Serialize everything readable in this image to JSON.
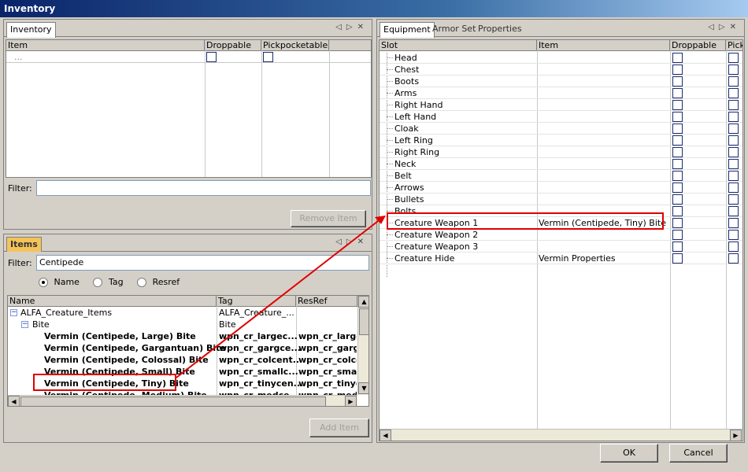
{
  "window": {
    "title": "Inventory"
  },
  "inventory_panel": {
    "tab": "Inventory",
    "columns": [
      "Item",
      "Droppable",
      "Pickpocketable"
    ],
    "placeholder_row": "...",
    "filter_label": "Filter:",
    "filter_value": "",
    "remove_button": "Remove Item"
  },
  "items_panel": {
    "tab": "Items",
    "filter_label": "Filter:",
    "filter_value": "Centipede",
    "radio": {
      "name": "Name",
      "tag": "Tag",
      "resref": "Resref",
      "selected": "Name"
    },
    "columns": [
      "Name",
      "Tag",
      "ResRef"
    ],
    "tree": [
      {
        "name": "ALFA_Creature_Items",
        "tag": "ALFA_Creature_...",
        "resref": ""
      },
      {
        "name": "Bite",
        "tag": "Bite",
        "resref": ""
      }
    ],
    "rows": [
      {
        "name": "Vermin (Centipede, Large) Bite",
        "tag": "wpn_cr_largec...",
        "resref": "wpn_cr_large"
      },
      {
        "name": "Vermin (Centipede, Gargantuan) Bite",
        "tag": "wpn_cr_gargce...",
        "resref": "wpn_cr_garg"
      },
      {
        "name": "Vermin (Centipede, Colossal) Bite",
        "tag": "wpn_cr_colcent...",
        "resref": "wpn_cr_colce"
      },
      {
        "name": "Vermin (Centipede, Small) Bite",
        "tag": "wpn_cr_smallc...",
        "resref": "wpn_cr_small"
      },
      {
        "name": "Vermin (Centipede, Tiny) Bite",
        "tag": "wpn_cr_tinycen...",
        "resref": "wpn_cr_tinyc"
      },
      {
        "name": "Vermin (Centipede, Medium) Bite",
        "tag": "wpn_cr_medce...",
        "resref": "wpn_cr_medc"
      }
    ],
    "add_button": "Add Item"
  },
  "equipment_panel": {
    "tabs": [
      "Equipment",
      "Armor Set",
      "Properties"
    ],
    "columns": [
      "Slot",
      "Item",
      "Droppable",
      "Pickp"
    ],
    "slots": [
      {
        "slot": "Head",
        "item": ""
      },
      {
        "slot": "Chest",
        "item": ""
      },
      {
        "slot": "Boots",
        "item": ""
      },
      {
        "slot": "Arms",
        "item": ""
      },
      {
        "slot": "Right Hand",
        "item": ""
      },
      {
        "slot": "Left Hand",
        "item": ""
      },
      {
        "slot": "Cloak",
        "item": ""
      },
      {
        "slot": "Left Ring",
        "item": ""
      },
      {
        "slot": "Right Ring",
        "item": ""
      },
      {
        "slot": "Neck",
        "item": ""
      },
      {
        "slot": "Belt",
        "item": ""
      },
      {
        "slot": "Arrows",
        "item": ""
      },
      {
        "slot": "Bullets",
        "item": ""
      },
      {
        "slot": "Bolts",
        "item": ""
      },
      {
        "slot": "Creature Weapon 1",
        "item": "Vermin (Centipede, Tiny) Bite"
      },
      {
        "slot": "Creature Weapon 2",
        "item": ""
      },
      {
        "slot": "Creature Weapon 3",
        "item": ""
      },
      {
        "slot": "Creature Hide",
        "item": "Vermin Properties"
      }
    ]
  },
  "dialog": {
    "ok": "OK",
    "cancel": "Cancel"
  },
  "colors": {
    "highlight_box": "#e00000",
    "items_tab": "#f4c35a",
    "title_bar": "#0a246a"
  }
}
